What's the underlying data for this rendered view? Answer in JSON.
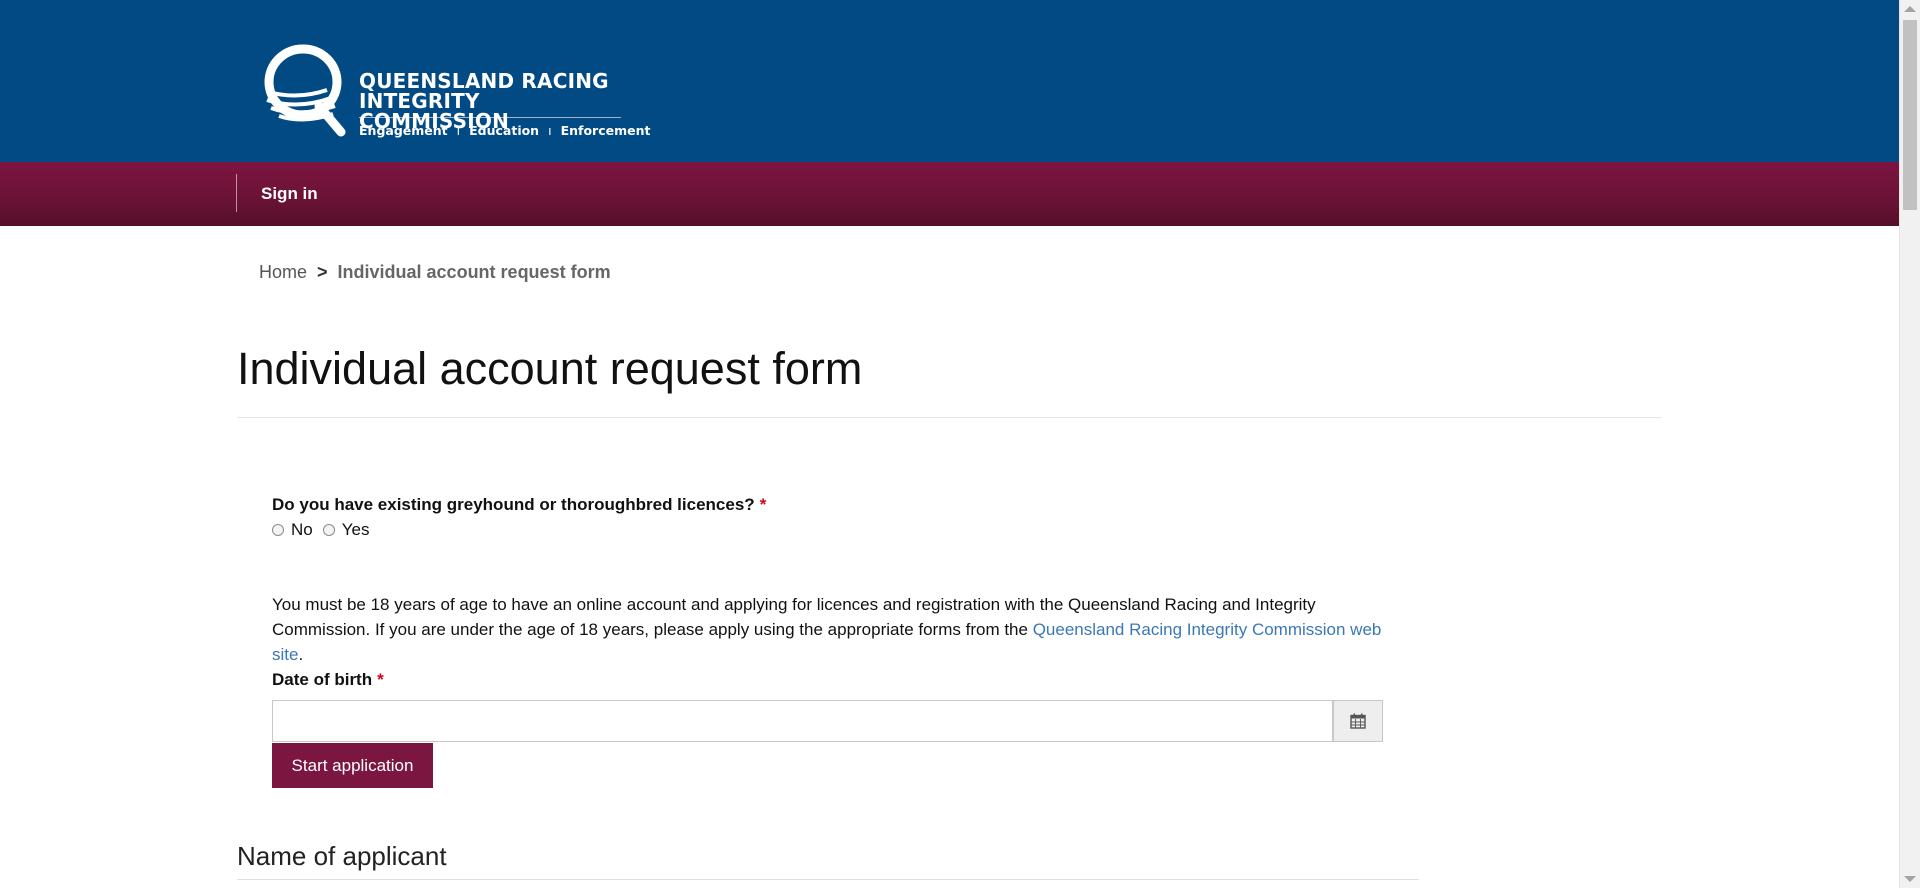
{
  "header": {
    "logo_line1": "QUEENSLAND RACING",
    "logo_line2": "INTEGRITY COMMISSION",
    "logo_tagline": [
      "Engagement",
      "Education",
      "Enforcement"
    ],
    "background_color": "#024a84"
  },
  "nav": {
    "sign_in_label": "Sign in",
    "background_color": "#7c1540"
  },
  "breadcrumb": {
    "home": "Home",
    "separator": ">",
    "current": "Individual account request form"
  },
  "page": {
    "title": "Individual account request form"
  },
  "form": {
    "licence_question": "Do you have existing greyhound or thoroughbred licences?",
    "required_marker": "*",
    "options": [
      "No",
      "Yes"
    ],
    "age_notice_text": "You must be 18 years of age to have an online account and applying for licences and registration with the Queensland Racing and Integrity Commission. If you are under the age of 18 years, please apply using the appropriate forms from the",
    "age_notice_link": "Queensland Racing Integrity Commission web site",
    "age_notice_end": ".",
    "dob_label": "Date of birth",
    "dob_value": "",
    "calendar_icon": "calendar-icon",
    "start_button": "Start application",
    "button_color": "#7b1640"
  },
  "section": {
    "title": "Name of applicant"
  }
}
